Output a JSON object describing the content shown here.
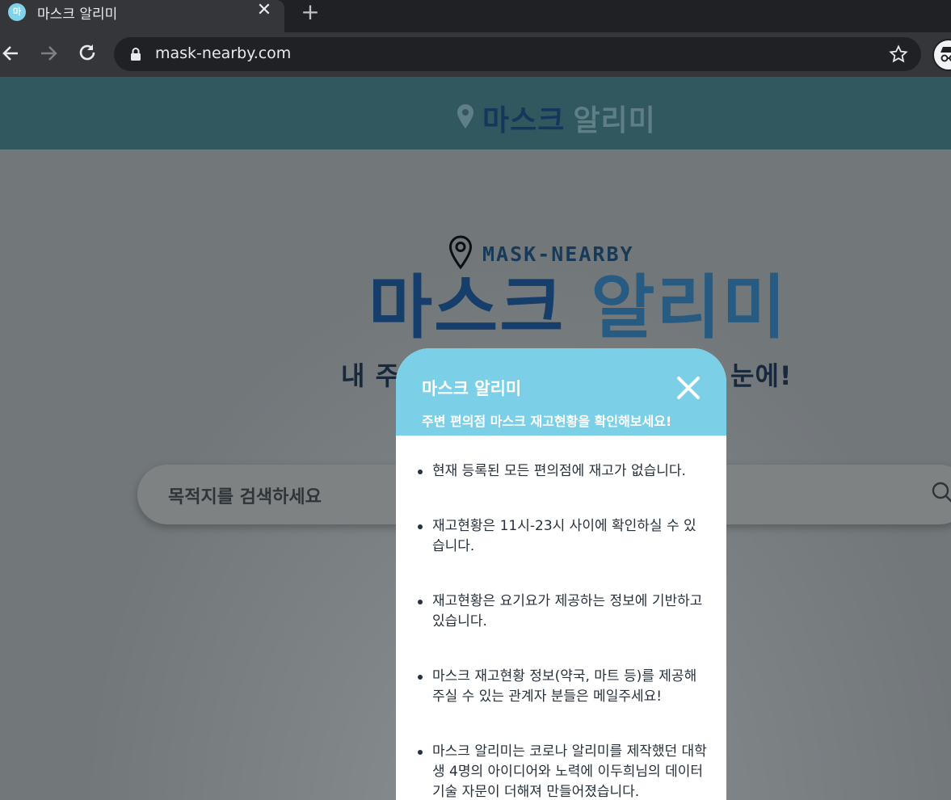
{
  "browser": {
    "tab_title": "마스크 알리미",
    "tab_favicon_text": "마",
    "url": "mask-nearby.com"
  },
  "header": {
    "brand_word1": "마스크",
    "brand_word2": "알리미"
  },
  "hero": {
    "subtitle": "MASK-NEARBY",
    "title_word1": "마스크",
    "title_word2": "알리미",
    "tagline_left": "내 주",
    "tagline_right": "눈에!"
  },
  "search": {
    "placeholder": "목적지를 검색하세요"
  },
  "modal": {
    "title": "마스크 알리미",
    "subtitle": "주변 편의점 마스크 재고현황을 확인해보세요!",
    "items": [
      {
        "text": "현재 등록된 모든 편의점에 재고가 없습니다."
      },
      {
        "text": "재고현황은 11시-23시 사이에 확인하실 수 있습니다."
      },
      {
        "text": "재고현황은 요기요가 제공하는 정보에 기반하고 있습니다."
      },
      {
        "text": "마스크 재고현황 정보(약국, 마트 등)를 제공해주실 수 있는 관계자 분들은 메일주세요!"
      },
      {
        "text": "마스크 알리미는 코로나 알리미를 제작했던 대학생 4명의 아이디어와 노력에 이두희님의 데이터 기술 자문이 더해져 만들어졌습니다."
      }
    ]
  },
  "colors": {
    "modal_header": "#7bcfe6",
    "site_header": "#32585f",
    "title_dark": "#153e6a"
  }
}
